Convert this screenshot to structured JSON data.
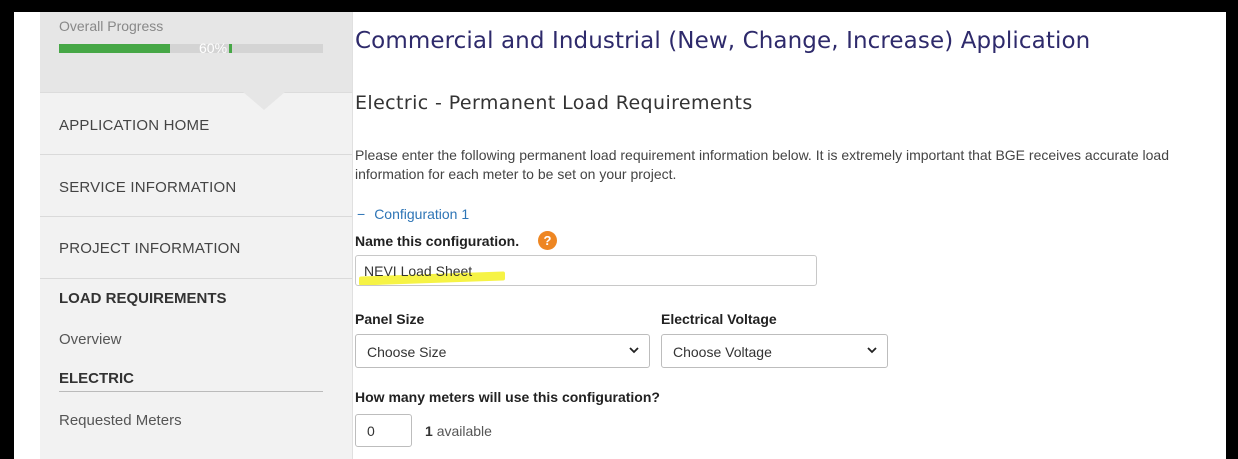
{
  "sidebar": {
    "progress": {
      "label": "Overall Progress",
      "percent_text": "60%",
      "percent": 0.6
    },
    "nav": [
      {
        "label": "APPLICATION HOME"
      },
      {
        "label": "SERVICE INFORMATION"
      },
      {
        "label": "PROJECT INFORMATION"
      }
    ],
    "load_requirements": {
      "heading": "LOAD REQUIREMENTS",
      "overview": "Overview",
      "electric_heading": "ELECTRIC",
      "requested_meters": "Requested Meters"
    }
  },
  "main": {
    "title": "Commercial and Industrial (New, Change, Increase) Application",
    "section_title": "Electric - Permanent Load Requirements",
    "intro": "Please enter the following permanent load requirement information below. It is extremely important that BGE receives accurate load information for each meter to be set on your project.",
    "configuration": {
      "toggle_symbol": "−",
      "toggle_label": "Configuration 1",
      "name_label": "Name this configuration.",
      "help_icon": "?",
      "name_value": "NEVI Load Sheet",
      "highlight_color": "#f5f23b",
      "panel_size": {
        "label": "Panel Size",
        "selected": "Choose Size"
      },
      "voltage": {
        "label": "Electrical Voltage",
        "selected": "Choose Voltage"
      },
      "meters": {
        "question": "How many meters will use this configuration?",
        "value": "0",
        "available_count": "1",
        "available_text": "available"
      }
    }
  },
  "colors": {
    "accent": "#2e75b6",
    "title": "#2e2a6b",
    "progress": "#46a746",
    "help": "#ee8622"
  }
}
